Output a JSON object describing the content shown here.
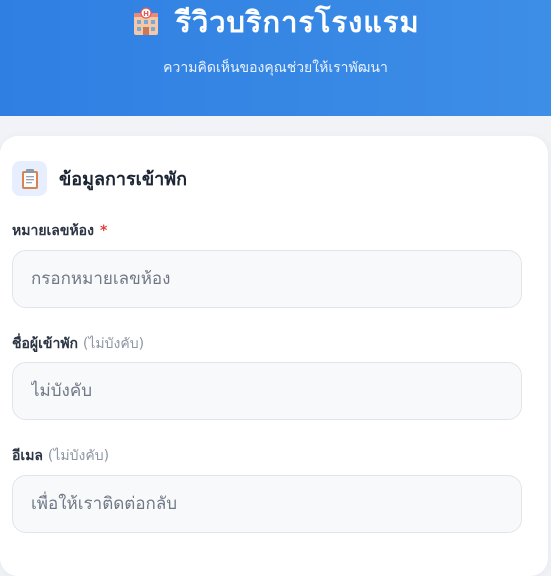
{
  "header": {
    "icon": "hotel-icon",
    "title": "รีวิวบริการโรงแรม",
    "subtitle": "ความคิดเห็นของคุณช่วยให้เราพัฒนา",
    "color": "#3184e4"
  },
  "section": {
    "icon": "clipboard-icon",
    "title": "ข้อมูลการเข้าพัก"
  },
  "fields": [
    {
      "label": "หมายเลขห้อง",
      "required_mark": "*",
      "optional_text": "",
      "value": "",
      "placeholder": "กรอกหมายเลขห้อง"
    },
    {
      "label": "ชื่อผู้เข้าพัก",
      "required_mark": "",
      "optional_text": "(ไม่บังคับ)",
      "value": "",
      "placeholder": "ไม่บังคับ"
    },
    {
      "label": "อีเมล",
      "required_mark": "",
      "optional_text": "(ไม่บังคับ)",
      "value": "",
      "placeholder": "เพื่อให้เราติดต่อกลับ"
    }
  ]
}
